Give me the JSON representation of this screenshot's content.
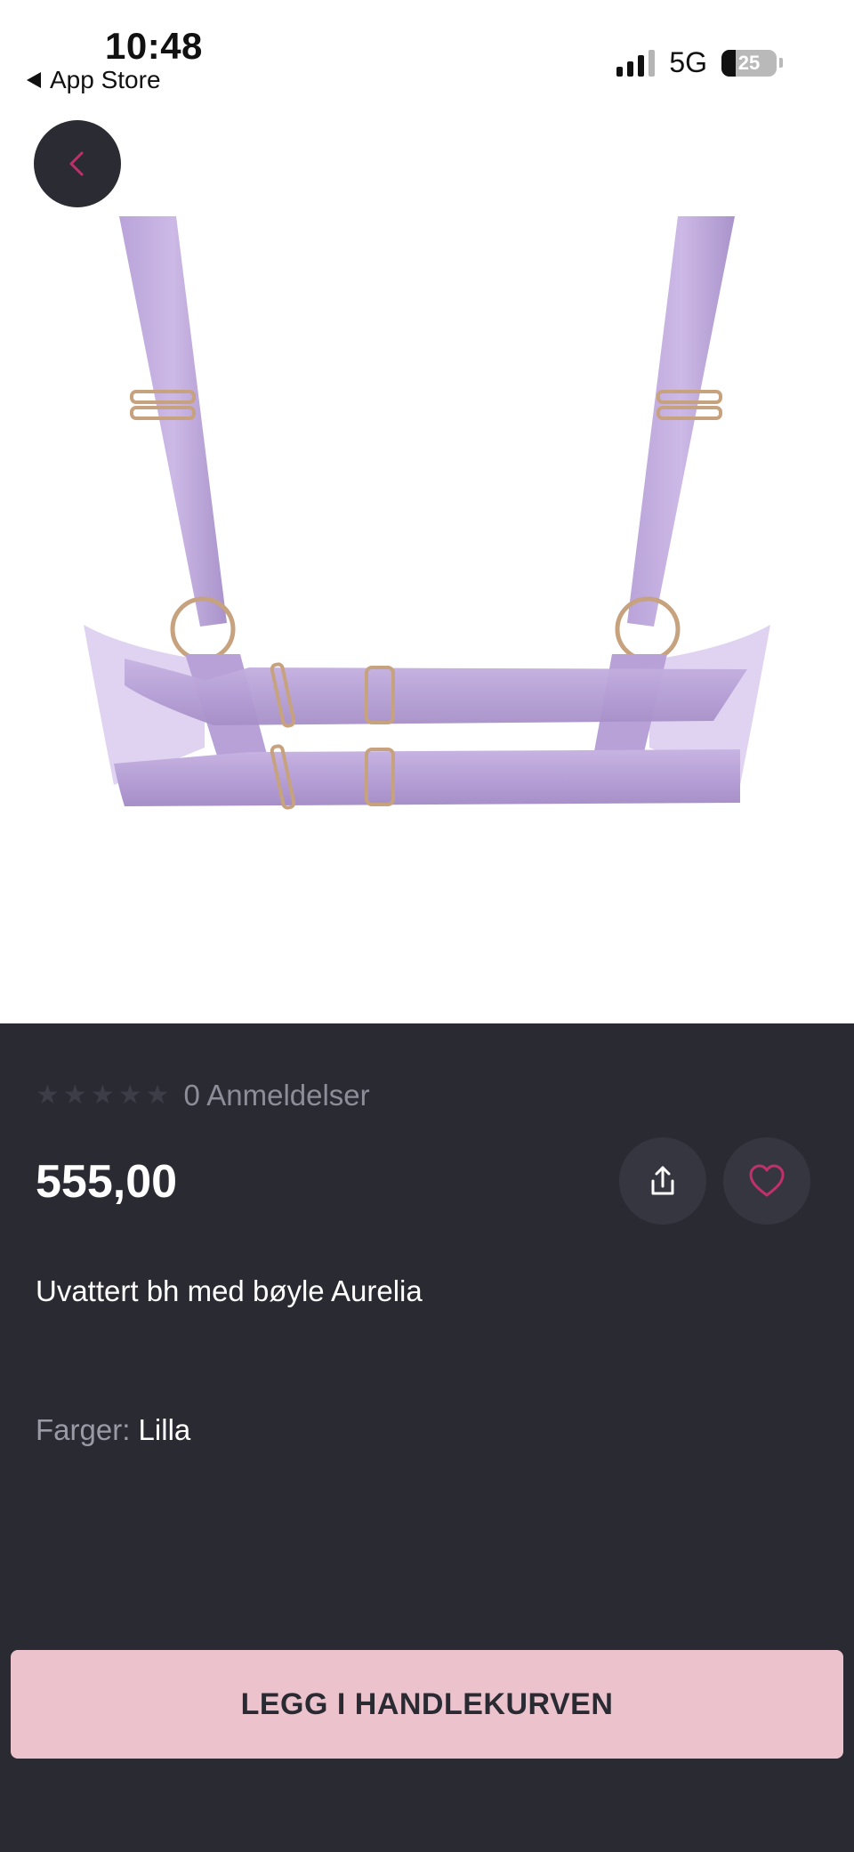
{
  "status_bar": {
    "time": "10:48",
    "back_app": "App Store",
    "network": "5G",
    "battery": "25",
    "battery_level": 0.25
  },
  "nav": {
    "back_icon": "chevron-left-icon",
    "accent_color": "#c0306a"
  },
  "product": {
    "image_icon": "product-bra-image",
    "rating_stars": 0,
    "reviews_label": "0 Anmeldelser",
    "price": "555,00",
    "title": "Uvattert bh med bøyle Aurelia",
    "colors_label": "Farger:",
    "colors_value": "Lilla",
    "share_icon": "share-icon",
    "favorite_icon": "heart-icon"
  },
  "actions": {
    "add_to_cart": "LEGG I HANDLEKURVEN",
    "cart_button_color": "#ecc3cc"
  }
}
